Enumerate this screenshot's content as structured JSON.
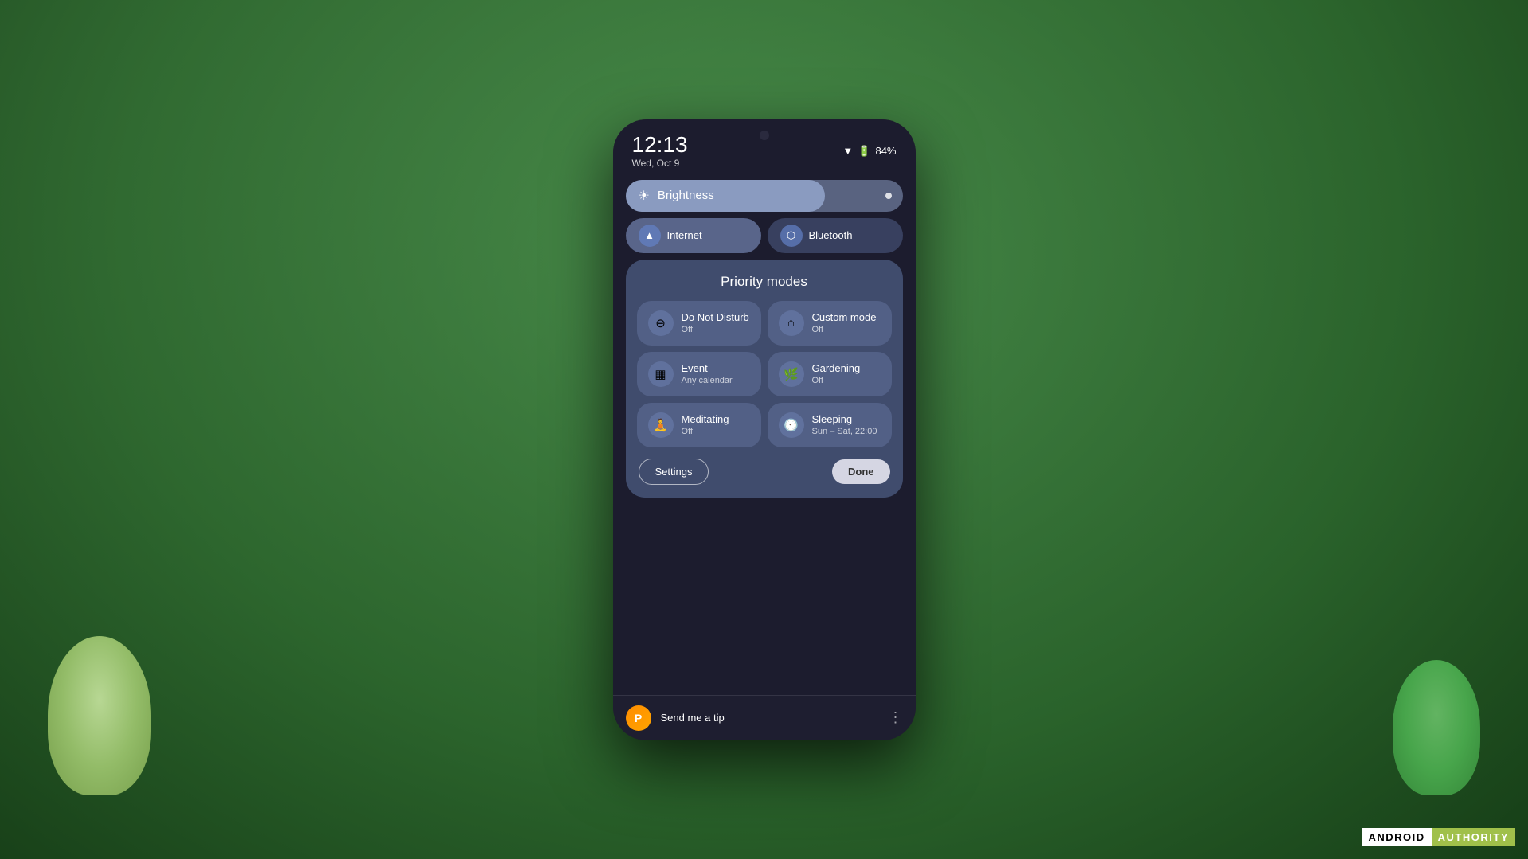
{
  "scene": {
    "watermark": {
      "part1": "ANDROID",
      "part2": "AUTHORITY"
    }
  },
  "phone": {
    "statusBar": {
      "time": "12:13",
      "date": "Wed, Oct 9",
      "battery": "84%",
      "batteryIcon": "🔋",
      "wifiIcon": "📶"
    },
    "quickSettings": {
      "brightness": {
        "label": "Brightness",
        "fillPercent": 72
      },
      "internet": {
        "label": "Internet",
        "icon": "📶"
      },
      "bluetooth": {
        "label": "Bluetooth",
        "icon": "🔵"
      }
    },
    "priorityModes": {
      "title": "Priority modes",
      "modes": [
        {
          "name": "Do Not Disturb",
          "status": "Off",
          "icon": "⊖",
          "id": "do-not-disturb"
        },
        {
          "name": "Custom mode",
          "status": "Off",
          "icon": "🏠",
          "id": "custom-mode"
        },
        {
          "name": "Event",
          "status": "Any calendar",
          "icon": "📅",
          "id": "event"
        },
        {
          "name": "Gardening",
          "status": "Off",
          "icon": "🌿",
          "id": "gardening"
        },
        {
          "name": "Meditating",
          "status": "Off",
          "icon": "🧘",
          "id": "meditating"
        },
        {
          "name": "Sleeping",
          "status": "Sun – Sat, 22:00",
          "icon": "🕙",
          "id": "sleeping"
        }
      ],
      "actions": {
        "settings": "Settings",
        "done": "Done"
      }
    },
    "tipBar": {
      "text": "Send me a tip",
      "iconLabel": "P"
    }
  }
}
